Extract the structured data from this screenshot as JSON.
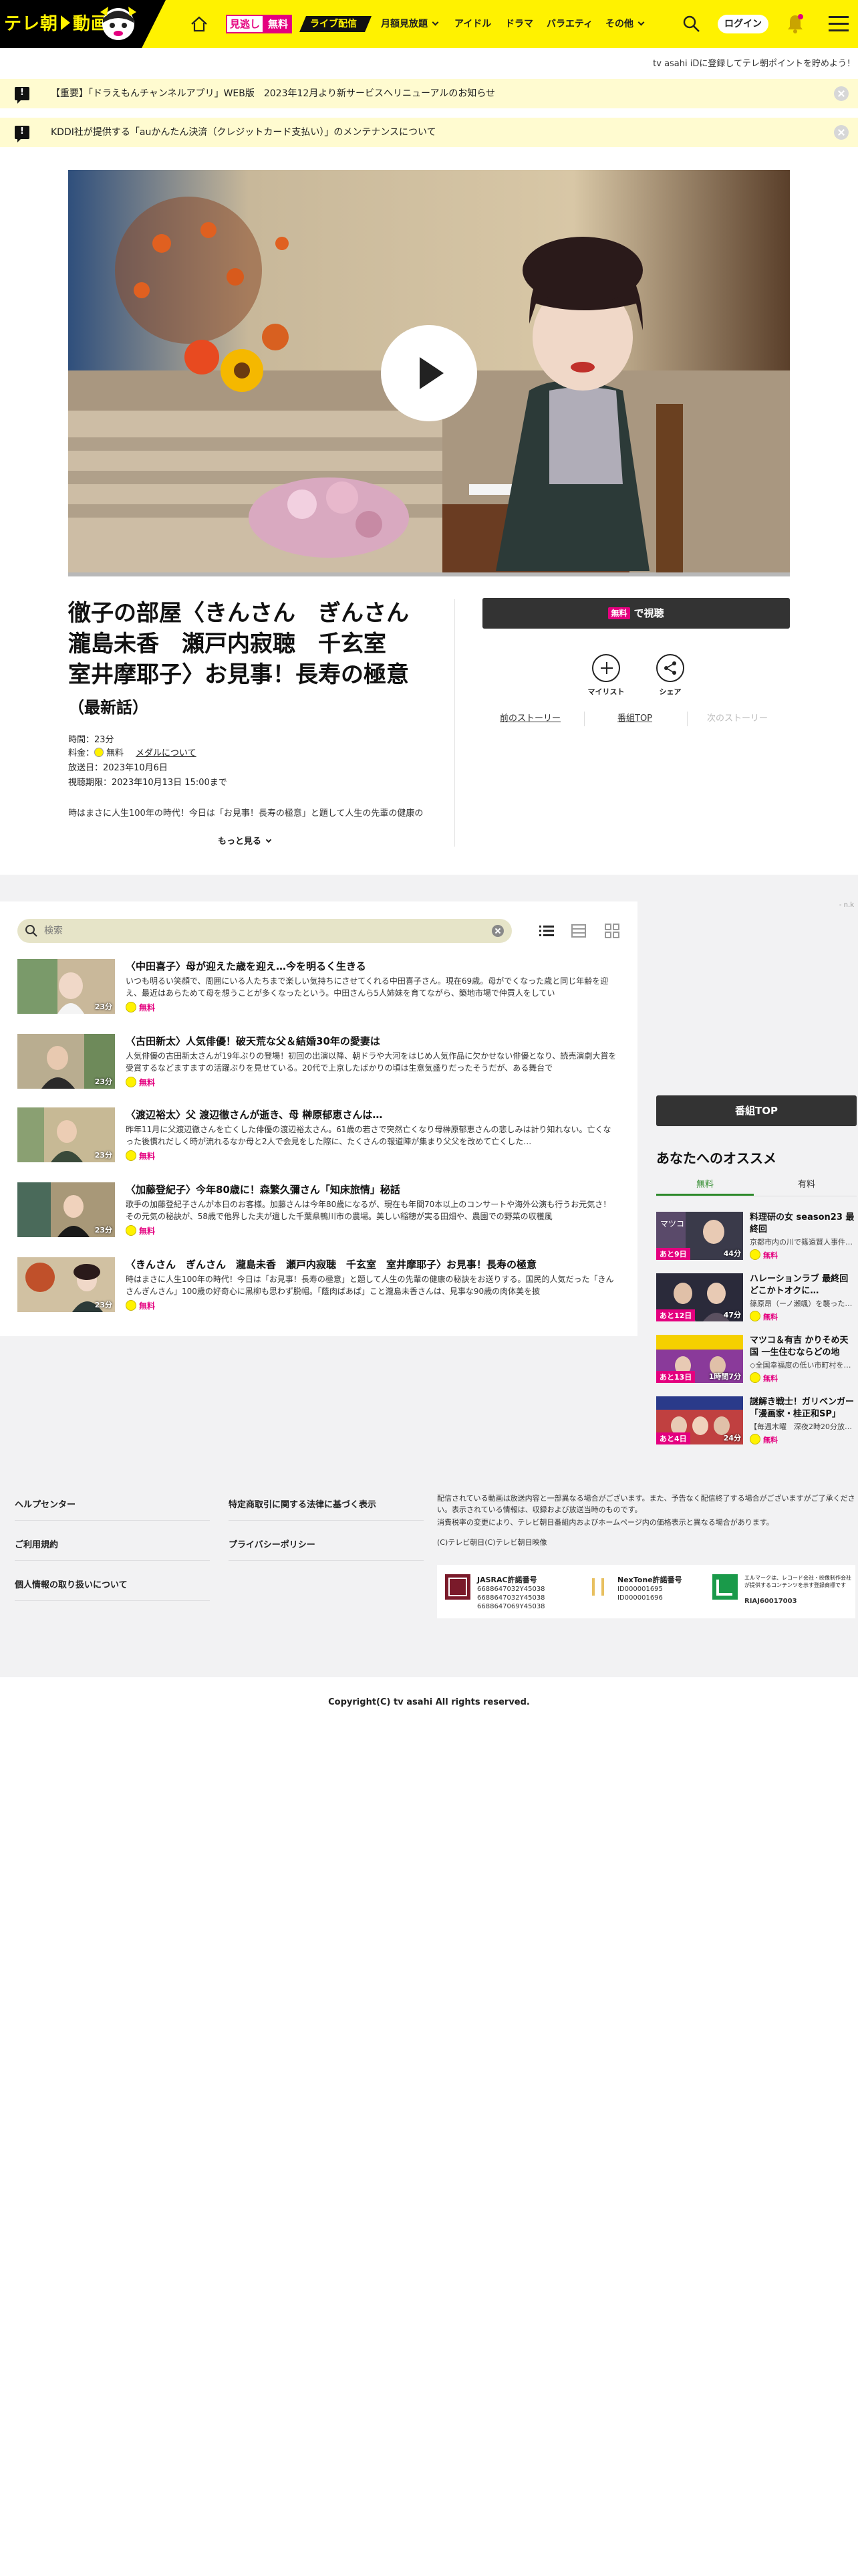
{
  "header": {
    "logo_text": "テレ朝",
    "logo_text2": "動画",
    "badge_mitoshi": "見逃し",
    "badge_free": "無料",
    "badge_live": "ライブ配信",
    "nav": [
      "月額見放題",
      "アイドル",
      "ドラマ",
      "バラエティ",
      "その他"
    ],
    "login": "ログイン"
  },
  "point_note": "tv asahi iDに登録してテレ朝ポイントを貯めよう！",
  "notices": [
    "【重要】「ドラえもんチャンネルアプリ」WEB版　2023年12月より新サービスへリニューアルのお知らせ",
    "KDDI社が提供する「auかんたん決済（クレジットカード支払い）」のメンテナンスについて"
  ],
  "episode": {
    "title": "徹子の部屋〈きんさん　ぎんさん　瀧島未香　瀬戸内寂聴　千玄室　室井摩耶子〉お見事！長寿の極意",
    "latest": "（最新話）",
    "duration": "時間：23分",
    "price_label": "料金：",
    "price": "無料",
    "medal_link": "メダルについて",
    "aired": "放送日：2023年10月6日",
    "deadline": "視聴期限：2023年10月13日 15:00まで",
    "description": "時はまさに人生100年の時代！今日は「お見事！長寿の極意」と題して人生の先輩の健康の",
    "more": "もっと見る"
  },
  "actions": {
    "watch_free": "無料",
    "watch_label": "で視聴",
    "mylist": "マイリスト",
    "share": "シェア",
    "prev": "前のストーリー",
    "top": "番組TOP",
    "next": "次のストーリー"
  },
  "episode_search": {
    "placeholder": "検索",
    "small_note": "- n.k"
  },
  "episodes": [
    {
      "title": "〈中田喜子〉母が迎えた歳を迎え…今を明るく生きる",
      "desc": "いつも明るい笑顔で、周囲にいる人たちまで楽しい気持ちにさせてくれる中田喜子さん。現在69歳。母がでくなった歳と同じ年齢を迎え、最近はあらためて母を想うことが多くなったという。中田さんら5人姉妹を育てながら、築地市場で仲買人をしてい",
      "dur": "23分",
      "free": "無料"
    },
    {
      "title": "〈古田新太〉人気俳優！破天荒な父＆結婚30年の愛妻は",
      "desc": "人気俳優の古田新太さんが19年ぶりの登場！初回の出演以降、朝ドラや大河をはじめ人気作品に欠かせない俳優となり、読売演劇大賞を受賞するなどますますの活躍ぶりを見せている。20代で上京したばかりの頃は生意気盛りだったそうだが、ある舞台で",
      "dur": "23分",
      "free": "無料"
    },
    {
      "title": "〈渡辺裕太〉父 渡辺徹さんが逝き、母 榊原郁恵さんは…",
      "desc": "昨年11月に父渡辺徹さんを亡くした俳優の渡辺裕太さん。61歳の若さで突然亡くなり母榊原郁恵さんの悲しみは計り知れない。亡くなった後慣れだしく時が流れるなか母と2人で会見をした際に、たくさんの報道陣が集まり父父を改めて亡くした…",
      "dur": "23分",
      "free": "無料"
    },
    {
      "title": "〈加藤登紀子〉今年80歳に！森繁久彌さん「知床旅情」秘話",
      "desc": "歌手の加藤登紀子さんが本日のお客様。加藤さんは今年80歳になるが、現在も年間70本以上のコンサートや海外公演も行うお元気さ！その元気の秘訣が、58歳で他界した夫が遺した千葉県鴨川市の農場。美しい稲穂が実る田畑や、農園での野菜の収穫風",
      "dur": "23分",
      "free": "無料"
    },
    {
      "title": "〈きんさん　ぎんさん　瀧島未香　瀬戸内寂聴　千玄室　室井摩耶子〉お見事！長寿の極意",
      "desc": "時はまさに人生100年の時代！今日は「お見事！長寿の極意」と題して人生の先輩の健康の秘訣をお送りする。国民的人気だった「きんさんぎんさん」100歳の好奇心に黒柳も思わず脱帽。「蔭肉ばあば」こと瀧島未香さんは、見事な90歳の肉体美を披",
      "dur": "23分",
      "free": "無料"
    }
  ],
  "sidebar": {
    "program_top": "番組TOP",
    "reco_heading": "あなたへのオススメ",
    "tabs": [
      "無料",
      "有料"
    ],
    "items": [
      {
        "title": "料理研の女 season23 最終回",
        "desc": "京都市内の川で篠遠賢人事件…",
        "remain": "あと9日",
        "dur": "44分",
        "free": "無料"
      },
      {
        "title": "ハレーションラブ 最終回　どこかトオクに…",
        "desc": "篠原昂（ーノ瀬颯）を襲った…",
        "remain": "あと12日",
        "dur": "47分",
        "free": "無料"
      },
      {
        "title": "マツコ＆有吉 かりそめ天国 一生住むならどの地域？…",
        "desc": "◇全国幸福度の低い市町村を…",
        "remain": "あと13日",
        "dur": "1時間7分",
        "free": "無料"
      },
      {
        "title": "謎解き戦士！ガリベンガー「漫画家・桂正和SP」",
        "desc": "【毎週木曜　深夜2時20分放…",
        "remain": "あと4日",
        "dur": "24分",
        "free": "無料"
      }
    ]
  },
  "footer": {
    "links_left": [
      "ヘルプセンター",
      "ご利用規約",
      "個人情報の取り扱いについて"
    ],
    "links_right": [
      "特定商取引に関する法律に基づく表示",
      "プライバシーポリシー"
    ],
    "note1": "配信されている動画は放送内容と一部異なる場合がございます。また、予告なく配信終了する場合がございますがご了承ください。表示されている情報は、収録および放送当時のものです。",
    "note2": "消費税率の変更により、テレビ朝日番組内およびホームページ内の価格表示と異なる場合があります。",
    "note3": "(C)テレビ朝日(C)テレビ朝日映像",
    "jasrac_title": "JASRAC許諾番号",
    "jasrac_lines": [
      "6688647032Y45038",
      "6688647032Y45038",
      "6688647069Y45038"
    ],
    "nextone_title": "NexTone許諾番号",
    "nextone_lines": [
      "ID000001695",
      "ID000001696"
    ],
    "lmark_title": "エルマークは、レコード会社・映像制作会社が提供するコンテンツを示す登録商標です",
    "lmark_lines": [
      "RIAJ60017003"
    ],
    "copyright": "Copyright(C) tv asahi All rights reserved."
  }
}
